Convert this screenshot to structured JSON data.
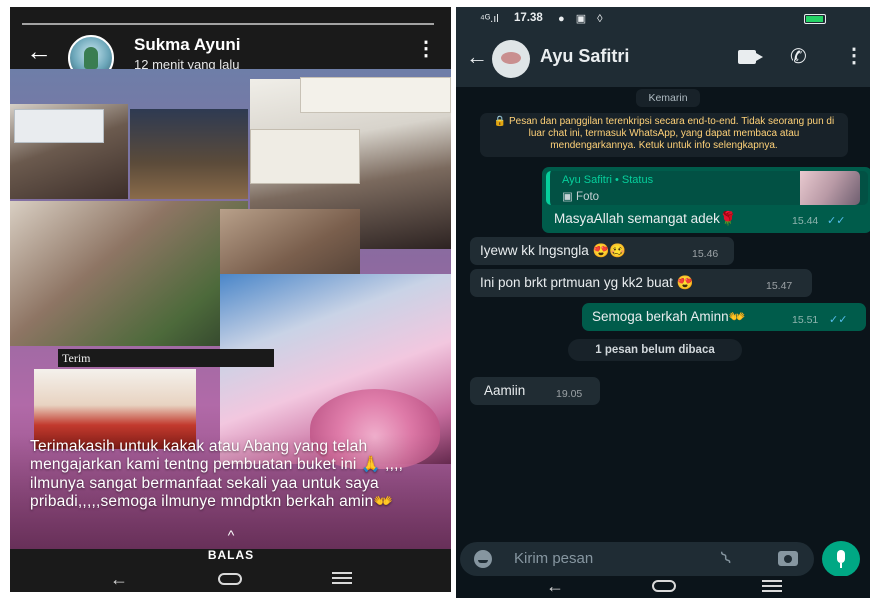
{
  "left_phone": {
    "story": {
      "contact_name": "Sukma Ayuni",
      "posted_time": "12 menit yang lalu",
      "crop_overlay_text": "Terim",
      "caption": "Terimakasih untuk kakak atau Abang yang telah mengajarkan kami tentng pembuatan buket ini 🙏 ,,,, ilmunya sangat bermanfaat sekali yaa untuk saya pribadi,,,,,semoga ilmunye mndptkn berkah amin👐",
      "reply_chevron": "^",
      "reply_label": "BALAS"
    },
    "icons": {
      "back": "arrow-left-icon",
      "menu": "more-vertical-icon"
    }
  },
  "right_phone": {
    "status_bar": {
      "signal": "⁴ᴳ.ıl",
      "time": "17.38",
      "notif_icons": "● ▣ ◊"
    },
    "header": {
      "contact_name": "Ayu Safitri"
    },
    "date_chip": "Kemarin",
    "encryption_note": "🔒 Pesan dan panggilan terenkripsi secara end-to-end. Tidak seorang pun di luar chat ini, termasuk WhatsApp, yang dapat membaca atau mendengarkannya. Ketuk untuk info selengkapnya.",
    "messages": [
      {
        "direction": "outgoing",
        "quote_title": "Ayu Safitri • Status",
        "quote_sub": "▣ Foto",
        "text": "MasyaAllah semangat adek🌹",
        "time": "15.44",
        "ticks": "✓✓"
      },
      {
        "direction": "incoming",
        "text": "Iyeww kk lngsngla 😍🥴",
        "time": "15.46"
      },
      {
        "direction": "incoming",
        "text": "Ini pon brkt prtmuan yg kk2 buat 😍",
        "time": "15.47"
      },
      {
        "direction": "outgoing",
        "text": "Semoga berkah Aminn👐",
        "time": "15.51",
        "ticks": "✓✓"
      }
    ],
    "unread_chip": "1 pesan belum dibaca",
    "after_unread": {
      "direction": "incoming",
      "text": "Aamiin",
      "time": "19.05"
    },
    "composer": {
      "placeholder": "Kirim pesan"
    }
  },
  "colors": {
    "whatsapp_bg": "#0b141a",
    "whatsapp_header": "#1f2c34",
    "outgoing_bubble": "#005c4b",
    "incoming_bubble": "#202c33",
    "accent_green": "#00a884",
    "encryption_text": "#ffd279",
    "read_ticks": "#53bdeb"
  }
}
